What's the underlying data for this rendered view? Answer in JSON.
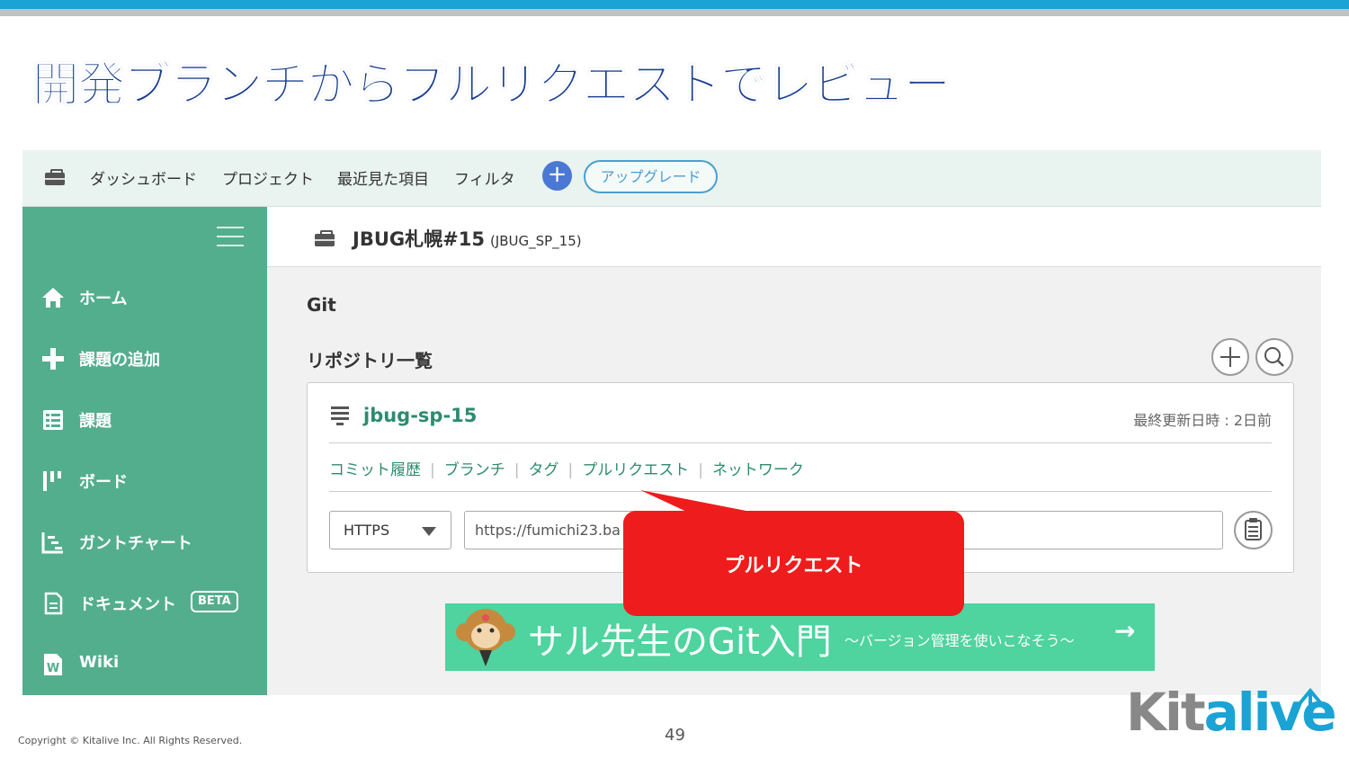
{
  "slide": {
    "title": "開発ブランチからプルリクエストでレビュー",
    "copyright": "Copyright © Kitalive Inc. All Rights Reserved.",
    "page_number": "49",
    "logo": {
      "part1": "Kit",
      "part2": "alive"
    }
  },
  "nav": {
    "items": [
      "ダッシュボード",
      "プロジェクト",
      "最近見た項目",
      "フィルタ"
    ],
    "add_icon": "plus-icon",
    "upgrade_label": "アップグレード"
  },
  "sidebar": {
    "items": [
      {
        "label": "ホーム",
        "icon": "home-icon"
      },
      {
        "label": "課題の追加",
        "icon": "plus-icon"
      },
      {
        "label": "課題",
        "icon": "list-icon"
      },
      {
        "label": "ボード",
        "icon": "board-icon"
      },
      {
        "label": "ガントチャート",
        "icon": "gantt-icon"
      },
      {
        "label": "ドキュメント",
        "icon": "document-icon",
        "badge": "BETA"
      },
      {
        "label": "Wiki",
        "icon": "wiki-icon"
      }
    ]
  },
  "project": {
    "name": "JBUG札幌#15",
    "key": "(JBUG_SP_15)"
  },
  "git": {
    "section_title": "Git",
    "repo_list_title": "リポジトリ一覧",
    "repo": {
      "name": "jbug-sp-15",
      "updated": "最終更新日時 : 2日前",
      "links": [
        "コミット履歴",
        "ブランチ",
        "タグ",
        "プルリクエスト",
        "ネットワーク"
      ],
      "protocol": "HTTPS",
      "url": "https://fumichi23.ba"
    }
  },
  "banner": {
    "title": "サル先生のGit入門",
    "subtitle": "〜バージョン管理を使いこなそう〜",
    "arrow": "→"
  },
  "callout": {
    "text": "プルリクエスト",
    "color": "#ee1c1c"
  },
  "colors": {
    "sidebar": "#53ae8e",
    "accent_blue": "#1aa3d4",
    "title_blue": "#1a3f8f",
    "link_green": "#2e8b6f"
  }
}
